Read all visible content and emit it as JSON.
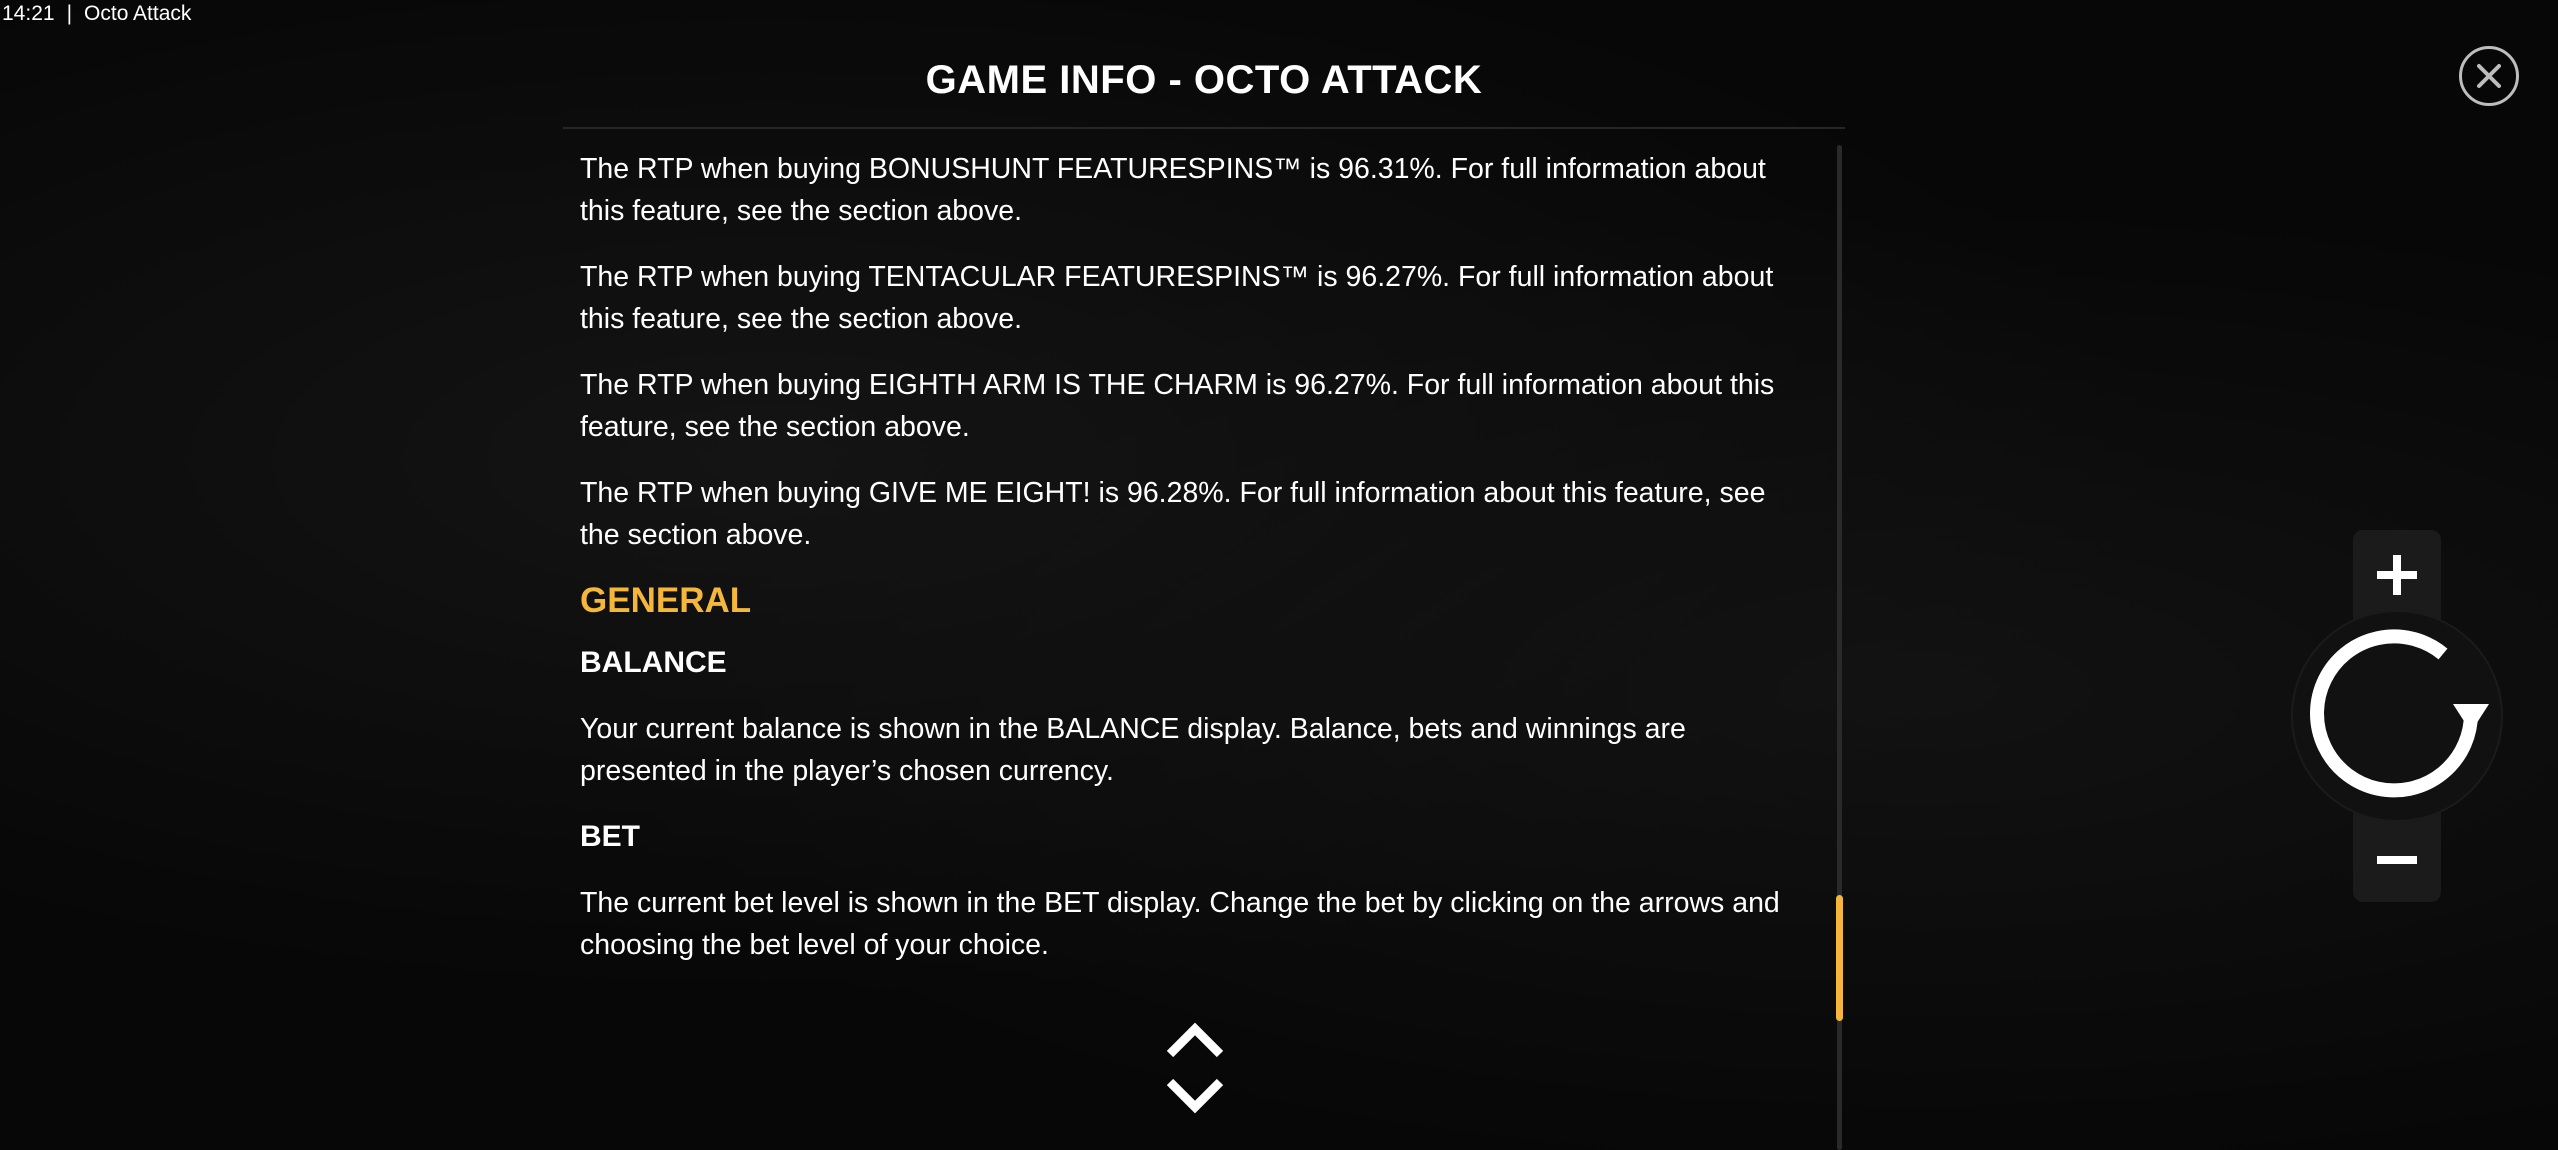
{
  "status_bar": {
    "time": "14:21",
    "separator": "|",
    "app_name": "Octo Attack"
  },
  "header": {
    "title": "GAME INFO - OCTO ATTACK"
  },
  "content": {
    "paragraphs_top": [
      "The RTP when buying BONUSHUNT FEATURESPINS™ is 96.31%. For full information about this feature, see the section above.",
      "The RTP when buying TENTACULAR FEATURESPINS™ is 96.27%. For full information about this feature, see the section above.",
      "The RTP when buying EIGHTH ARM IS THE CHARM is 96.27%. For full information about this feature, see the section above.",
      "The RTP when buying GIVE ME EIGHT! is 96.28%. For full information about this feature, see the section above."
    ],
    "section_title": "GENERAL",
    "balance": {
      "heading": "BALANCE",
      "text": "Your current balance is shown in the BALANCE display. Balance, bets and winnings are presented in the player’s chosen currency."
    },
    "bet": {
      "heading": "BET",
      "text": "The current bet level is shown in the BET display. Change the bet by clicking on the arrows and choosing the bet level of your choice."
    }
  },
  "icons": {
    "close": "close-icon",
    "scroll_up": "chevron-up-icon",
    "scroll_down": "chevron-down-icon",
    "bet_increase": "plus-icon",
    "spin": "spin-refresh-icon",
    "bet_decrease": "minus-icon"
  },
  "colors": {
    "background": "#070707",
    "accent": "#f4b73b",
    "text": "#ffffff",
    "panel": "#1b1b1b"
  },
  "scroll": {
    "position_fraction": 0.87
  }
}
